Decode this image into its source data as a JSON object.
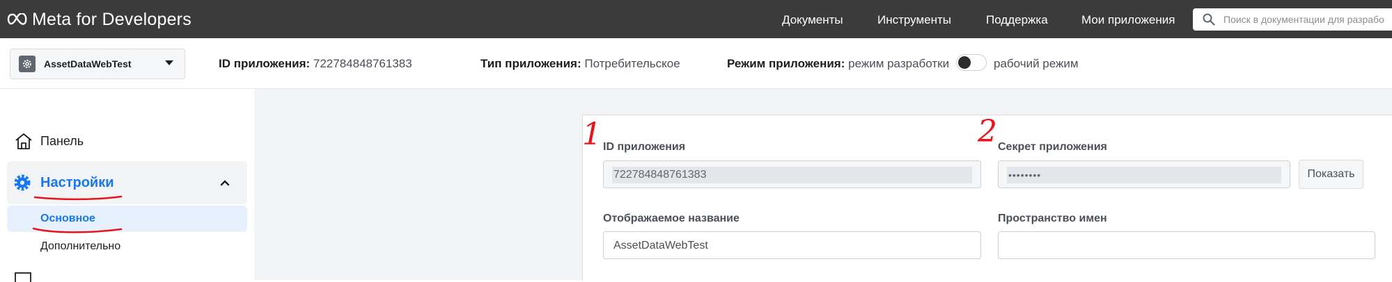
{
  "topbar": {
    "brand": "Meta for Developers",
    "nav": [
      "Документы",
      "Инструменты",
      "Поддержка",
      "Мои приложения"
    ],
    "search_placeholder": "Поиск в документации для разрабо"
  },
  "appbar": {
    "app_name": "AssetDataWebTest",
    "app_id_label": "ID приложения:",
    "app_id_value": "722784848761383",
    "app_type_label": "Тип приложения:",
    "app_type_value": "Потребительское",
    "app_mode_label": "Режим приложения:",
    "app_mode_dev": "режим разработки",
    "app_mode_live": "рабочий режим",
    "live_mode_on": false
  },
  "sidebar": {
    "panel_label": "Панель",
    "settings_label": "Настройки",
    "sub_items": [
      "Основное",
      "Дополнительно"
    ]
  },
  "form": {
    "app_id_label": "ID приложения",
    "app_id_value": "722784848761383",
    "secret_label": "Секрет приложения",
    "secret_value": "••••••••",
    "show_button": "Показать",
    "display_name_label": "Отображаемое название",
    "display_name_value": "AssetDataWebTest",
    "namespace_label": "Пространство имен",
    "namespace_value": ""
  },
  "annotations": {
    "mark1": "1",
    "mark2": "2",
    "color": "#e8141b"
  },
  "colors": {
    "accent": "#1877f2",
    "topbar": "#3b3b3b"
  }
}
